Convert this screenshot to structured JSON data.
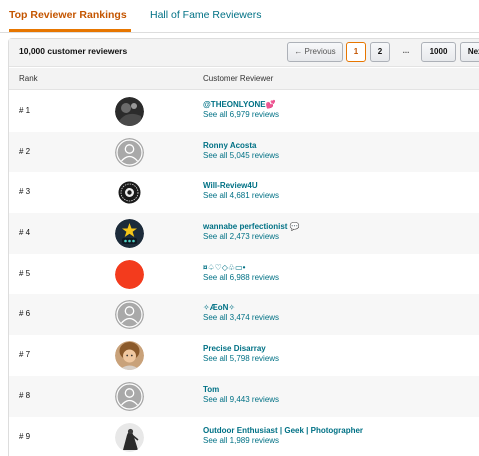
{
  "tabs": {
    "active": "Top Reviewer Rankings",
    "inactive": "Hall of Fame Reviewers"
  },
  "header": {
    "count": "10,000 customer reviewers"
  },
  "pagination": {
    "previous": "← Previous",
    "page1": "1",
    "page2": "2",
    "ellipsis": "...",
    "last": "1000",
    "next": "Next"
  },
  "columns": {
    "rank": "Rank",
    "reviewer": "Customer Reviewer"
  },
  "reviewers": [
    {
      "rank": "# 1",
      "name": "@THEONLYONE",
      "suffix": "💕",
      "reviews": "See all 6,979 reviews",
      "avatar": "photo-dark"
    },
    {
      "rank": "# 2",
      "name": "Ronny Acosta",
      "suffix": "",
      "reviews": "See all 5,045 reviews",
      "avatar": "default"
    },
    {
      "rank": "# 3",
      "name": "Will-Review4U",
      "suffix": "",
      "reviews": "See all 4,681 reviews",
      "avatar": "logo-badge"
    },
    {
      "rank": "# 4",
      "name": "wannabe perfectionist",
      "suffix": "💬",
      "reviews": "See all 2,473 reviews",
      "avatar": "star-mascot"
    },
    {
      "rank": "# 5",
      "name": "¤♤♡◇♧▭•",
      "suffix": "",
      "reviews": "See all 6,988 reviews",
      "avatar": "red-circle"
    },
    {
      "rank": "# 6",
      "name": "✧ÆoN✧",
      "suffix": "",
      "reviews": "See all 3,474 reviews",
      "avatar": "default"
    },
    {
      "rank": "# 7",
      "name": "Precise Disarray",
      "suffix": "",
      "reviews": "See all 5,798 reviews",
      "avatar": "photo-person"
    },
    {
      "rank": "# 8",
      "name": "Tom",
      "suffix": "",
      "reviews": "See all 9,443 reviews",
      "avatar": "default"
    },
    {
      "rank": "# 9",
      "name": "Outdoor Enthusiast | Geek | Photographer",
      "suffix": "",
      "reviews": "See all 1,989 reviews",
      "avatar": "photo-bw"
    }
  ],
  "colors": {
    "accent": "#e77600",
    "link": "#007185"
  }
}
